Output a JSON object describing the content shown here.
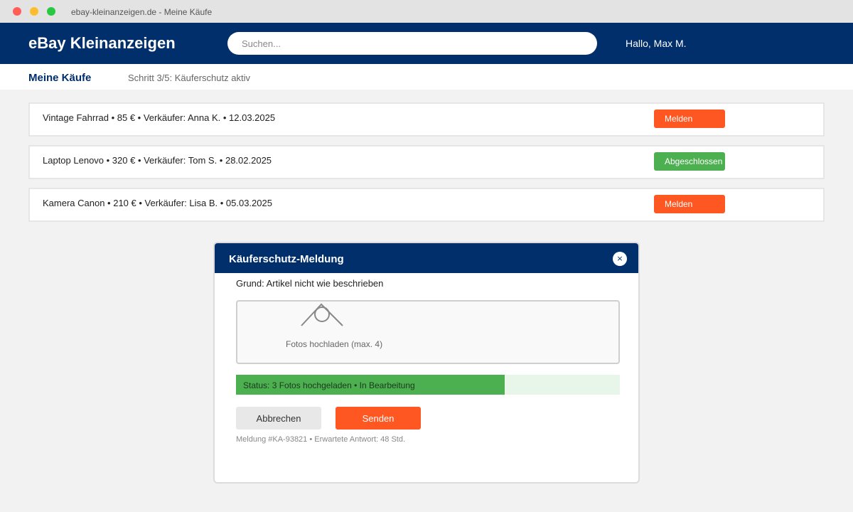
{
  "window": {
    "title": "ebay-kleinanzeigen.de - Meine Käufe"
  },
  "header": {
    "brand": "eBay Kleinanzeigen",
    "search_placeholder": "Suchen...",
    "greeting": "Hallo, Max M."
  },
  "subheader": {
    "title": "Meine Käufe",
    "step": "Schritt 3/5: Käuferschutz aktiv"
  },
  "purchases": [
    {
      "text": "Vintage Fahrrad • 85 € • Verkäufer: Anna K. • 12.03.2025",
      "action": "Melden",
      "status_color": "#ff5722"
    },
    {
      "text": "Laptop Lenovo • 320 € • Verkäufer: Tom S. • 28.02.2025",
      "action": "Abgeschlossen",
      "status_color": "#4caf50"
    },
    {
      "text": "Kamera Canon • 210 € • Verkäufer: Lisa B. • 05.03.2025",
      "action": "Melden",
      "status_color": "#ff5722"
    }
  ],
  "modal": {
    "title": "Käuferschutz-Meldung",
    "close_label": "×",
    "reason": "Grund: Artikel nicht wie beschrieben",
    "upload_label": "Fotos hochladen (max. 4)",
    "upload_icon": "camera-icon",
    "progress": {
      "text": "Status: 3 Fotos hochgeladen • In Bearbeitung",
      "fraction": 0.7
    },
    "cancel_label": "Abbrechen",
    "send_label": "Senden",
    "meta": "Meldung #KA-93821 • Erwartete Antwort: 48 Std."
  },
  "colors": {
    "brand": "#002f6c",
    "report": "#ff5722",
    "done": "#4caf50"
  }
}
